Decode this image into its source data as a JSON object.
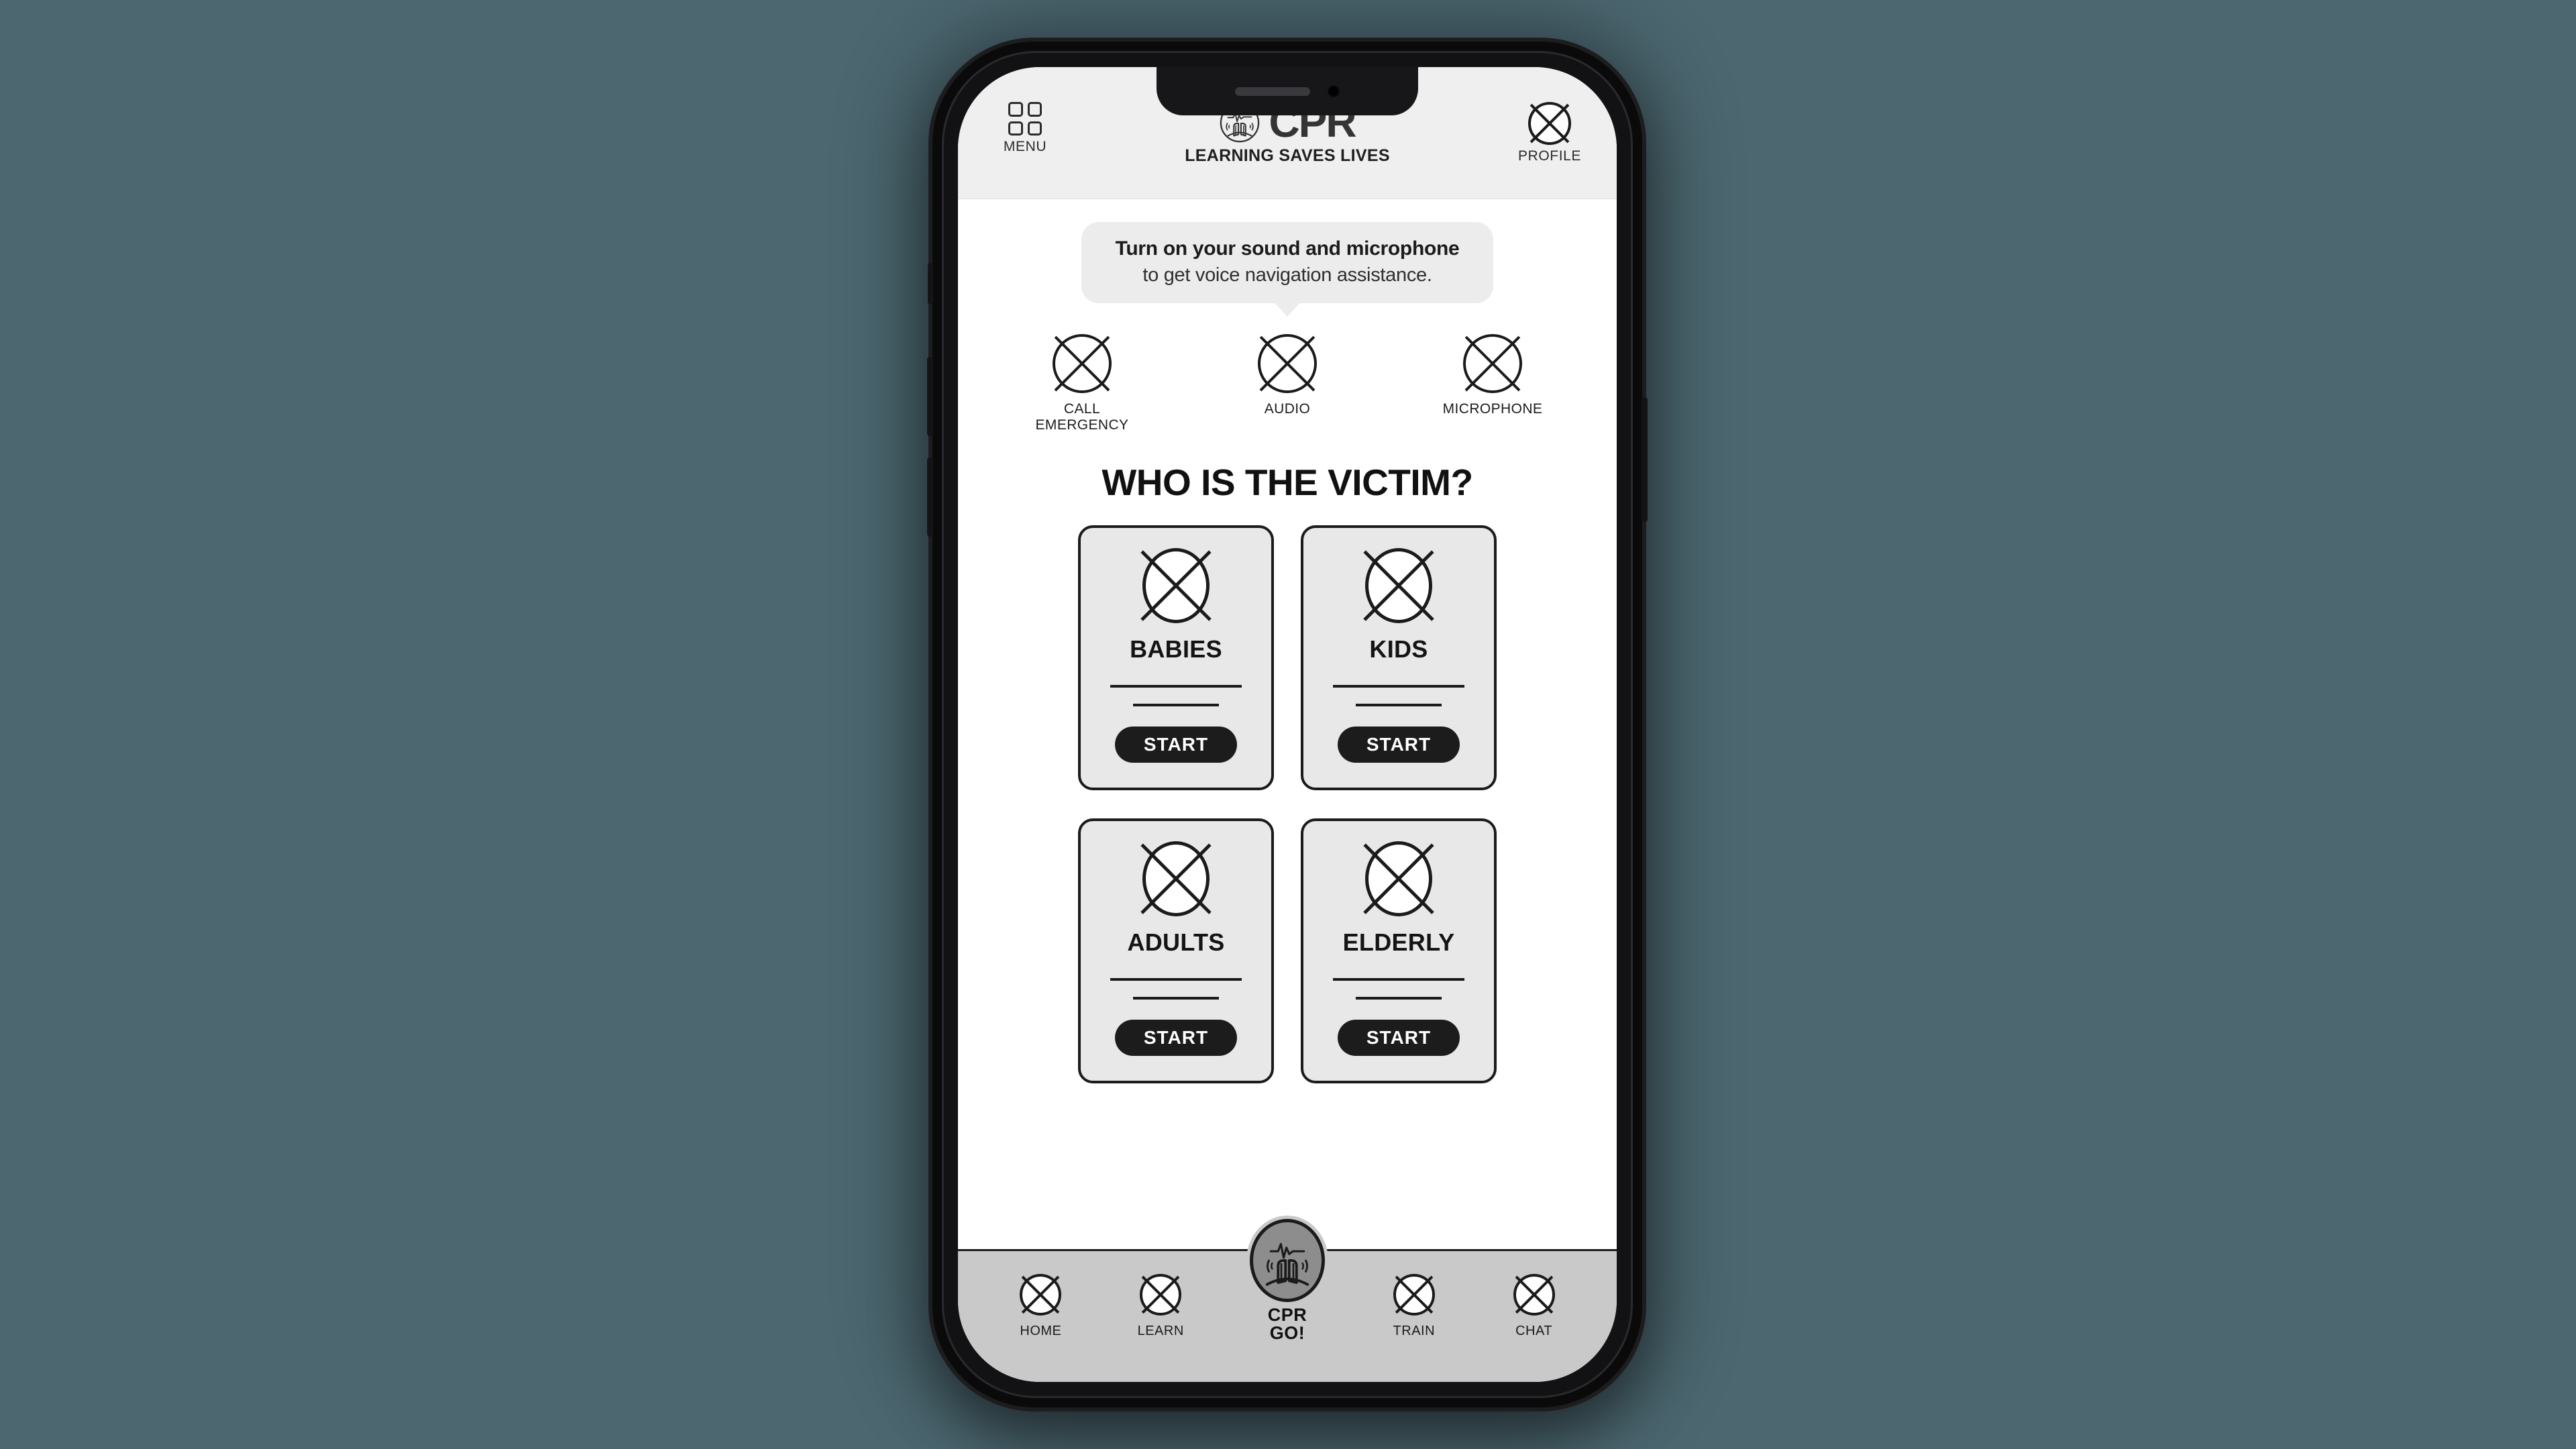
{
  "theme": {
    "page_background": "#4c6770",
    "header_background": "#efefef",
    "card_background": "#e8e8e8",
    "nav_background": "#c9c9c9",
    "accent_dark": "#1b1b1b",
    "bubble_background": "#ececec"
  },
  "header": {
    "menu": {
      "label": "MENU",
      "icon": "grid-menu-icon"
    },
    "brand": {
      "logo_icon": "cpr-clasped-hands-heartbeat-logo",
      "wordmark": "CPR",
      "tagline": "LEARNING SAVES LIVES"
    },
    "profile": {
      "label": "PROFILE",
      "icon": "profile-placeholder-icon"
    }
  },
  "voice_tip": {
    "title": "Turn on your sound and microphone",
    "subtitle": "to get voice navigation assistance."
  },
  "quick_actions": [
    {
      "label": "CALL\nEMERGENCY",
      "label_line1": "CALL",
      "label_line2": "EMERGENCY",
      "icon": "call-emergency-placeholder-icon"
    },
    {
      "label": "AUDIO",
      "label_line1": "AUDIO",
      "label_line2": "",
      "icon": "audio-placeholder-icon"
    },
    {
      "label": "MICROPHONE",
      "label_line1": "MICROPHONE",
      "label_line2": "",
      "icon": "microphone-placeholder-icon"
    }
  ],
  "section": {
    "title": "WHO IS THE VICTIM?"
  },
  "victim_cards": [
    {
      "title": "BABIES",
      "button_label": "START",
      "icon": "babies-placeholder-icon"
    },
    {
      "title": "KIDS",
      "button_label": "START",
      "icon": "kids-placeholder-icon"
    },
    {
      "title": "ADULTS",
      "button_label": "START",
      "icon": "adults-placeholder-icon"
    },
    {
      "title": "ELDERLY",
      "button_label": "START",
      "icon": "elderly-placeholder-icon"
    }
  ],
  "bottom_nav": {
    "left_items": [
      {
        "label": "HOME",
        "icon": "home-placeholder-icon"
      },
      {
        "label": "LEARN",
        "icon": "learn-placeholder-icon"
      }
    ],
    "center": {
      "line1": "CPR",
      "line2": "GO!",
      "icon": "cpr-clasped-hands-heartbeat-badge"
    },
    "right_items": [
      {
        "label": "TRAIN",
        "icon": "train-placeholder-icon"
      },
      {
        "label": "CHAT",
        "icon": "chat-placeholder-icon"
      }
    ]
  }
}
